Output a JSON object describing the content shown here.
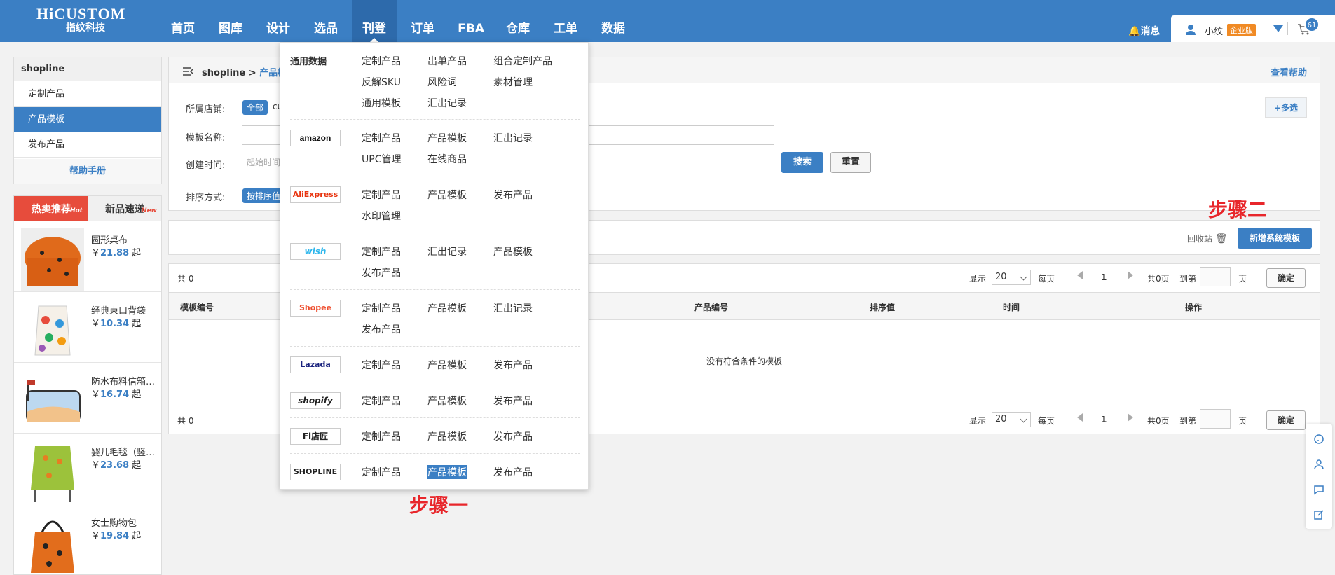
{
  "brand": {
    "logo_top": "HiCUSTOM",
    "logo_bottom": "指纹科技"
  },
  "nav": [
    "首页",
    "图库",
    "设计",
    "选品",
    "刊登",
    "订单",
    "FBA",
    "仓库",
    "工单",
    "数据"
  ],
  "nav_active": "刊登",
  "header": {
    "messages": "消息",
    "user": "小纹",
    "edition": "企业版",
    "cart_count": "61"
  },
  "sidebar": {
    "title": "shopline",
    "items": [
      "定制产品",
      "产品模板",
      "发布产品"
    ],
    "active": "产品模板",
    "help": "帮助手册"
  },
  "promo": {
    "tab_hot": "热卖推荐",
    "tab_hot_sup": "Hot",
    "tab_new": "新品速递",
    "tab_new_sup": "New",
    "products": [
      {
        "name": "圆形桌布",
        "currency": "￥",
        "price": "21.88",
        "suffix": " 起"
      },
      {
        "name": "经典束口背袋",
        "currency": "￥",
        "price": "10.34",
        "suffix": " 起"
      },
      {
        "name": "防水布料信箱套...",
        "currency": "￥",
        "price": "16.74",
        "suffix": " 起"
      },
      {
        "name": "婴儿毛毯（竖款）",
        "currency": "￥",
        "price": "23.68",
        "suffix": " 起"
      },
      {
        "name": "女士购物包",
        "currency": "￥",
        "price": "19.84",
        "suffix": " 起"
      }
    ]
  },
  "breadcrumb": {
    "root": "shopline > ",
    "current": "产品模板",
    "help": "查看帮助"
  },
  "filter": {
    "store_label": "所属店铺:",
    "store_all": "全部",
    "store_partial": "cu",
    "multi": "+多选",
    "name_label": "模板名称:",
    "time_label": "创建时间:",
    "time_placeholder": "起始时间",
    "search": "搜索",
    "reset": "重置",
    "sort_label": "排序方式:",
    "sort_value": "按排序值"
  },
  "actions": {
    "trash": "回收站",
    "add": "新增系统模板"
  },
  "pager": {
    "total": "共 0",
    "show": "显示",
    "size": "20",
    "per": "每页",
    "page": "1",
    "pages": "共0页",
    "goto": "到第",
    "page_unit": "页",
    "ok": "确定"
  },
  "table": {
    "columns": [
      "模板编号",
      "产品编号",
      "排序值",
      "时间",
      "操作"
    ],
    "empty": "没有符合条件的模板"
  },
  "dropdown": {
    "sections": [
      {
        "head": "通用数据",
        "links": [
          "定制产品",
          "出单产品",
          "组合定制产品",
          "反解SKU",
          "风险词",
          "素材管理",
          "通用模板",
          "汇出记录"
        ]
      },
      {
        "logo": "amazon",
        "links": [
          "定制产品",
          "产品模板",
          "汇出记录",
          "UPC管理",
          "在线商品"
        ]
      },
      {
        "logo": "AliExpress",
        "links": [
          "定制产品",
          "产品模板",
          "发布产品",
          "水印管理"
        ]
      },
      {
        "logo": "wish",
        "links": [
          "定制产品",
          "汇出记录",
          "产品模板",
          "发布产品"
        ]
      },
      {
        "logo": "Shopee",
        "links": [
          "定制产品",
          "产品模板",
          "汇出记录",
          "发布产品"
        ]
      },
      {
        "logo": "Lazada",
        "links": [
          "定制产品",
          "产品模板",
          "发布产品"
        ]
      },
      {
        "logo": "shopify",
        "links": [
          "定制产品",
          "产品模板",
          "发布产品"
        ]
      },
      {
        "logo": "Fi店匠",
        "links": [
          "定制产品",
          "产品模板",
          "发布产品"
        ]
      },
      {
        "logo": "SHOPLINE",
        "links": [
          "定制产品",
          "产品模板",
          "发布产品"
        ]
      }
    ],
    "selected": "产品模板"
  },
  "annotations": {
    "step1": "步骤一",
    "step2": "步骤二"
  },
  "colors": {
    "primary": "#3b7fc4",
    "hot": "#e74c3c",
    "step": "#e8262b",
    "edition": "#f08a24"
  }
}
